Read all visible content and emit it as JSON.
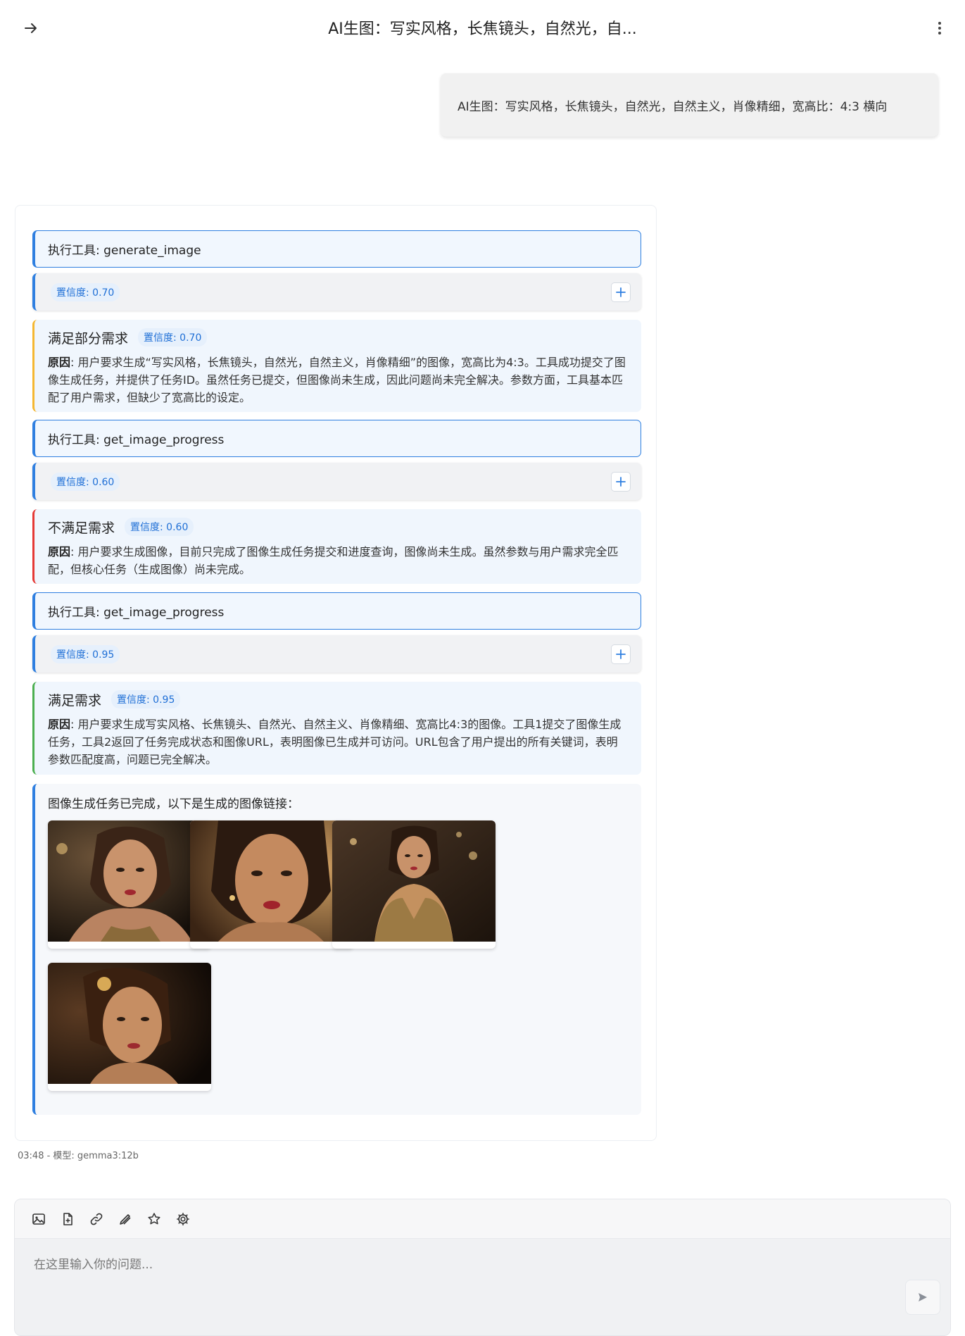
{
  "header": {
    "title": "AI生图：写实风格，长焦镜头，自然光，自..."
  },
  "user_message": {
    "text": "AI生图：写实风格，长焦镜头，自然光，自然主义，肖像精细，宽高比：4:3 横向"
  },
  "steps": [
    {
      "tool_label": "执行工具: generate_image",
      "confidence": "置信度: 0.70"
    },
    {
      "status": "满足部分需求",
      "confidence": "置信度: 0.70",
      "reason_label": "原因",
      "reason": ": 用户要求生成“写实风格，长焦镜头，自然光，自然主义，肖像精细”的图像，宽高比为4:3。工具成功提交了图像生成任务，并提供了任务ID。虽然任务已提交，但图像尚未生成，因此问题尚未完全解决。参数方面，工具基本匹配了用户需求，但缺少了宽高比的设定。"
    },
    {
      "tool_label": "执行工具: get_image_progress",
      "confidence": "置信度: 0.60"
    },
    {
      "status": "不满足需求",
      "confidence": "置信度: 0.60",
      "reason_label": "原因",
      "reason": ": 用户要求生成图像，目前只完成了图像生成任务提交和进度查询，图像尚未生成。虽然参数与用户需求完全匹配，但核心任务（生成图像）尚未完成。"
    },
    {
      "tool_label": "执行工具: get_image_progress",
      "confidence": "置信度: 0.95"
    },
    {
      "status": "满足需求",
      "confidence": "置信度: 0.95",
      "reason_label": "原因",
      "reason": ": 用户要求生成写实风格、长焦镜头、自然光、自然主义、肖像精细、宽高比4:3的图像。工具1提交了图像生成任务，工具2返回了任务完成状态和图像URL，表明图像已生成并可访问。URL包含了用户提出的所有关键词，表明参数匹配度高，问题已完全解决。"
    }
  ],
  "result": {
    "text": "图像生成任务已完成，以下是生成的图像链接：",
    "images": [
      "generated-portrait-1",
      "generated-portrait-2",
      "generated-portrait-3",
      "generated-portrait-4"
    ]
  },
  "meta": "03:48 - 模型: gemma3:12b",
  "input": {
    "placeholder": "在这里输入你的问题...",
    "toolbar_icons": [
      "image-icon",
      "file-add-icon",
      "link-icon",
      "pen-icon",
      "star-icon",
      "gear-icon"
    ],
    "send_icon": "send-icon"
  },
  "colors": {
    "accent": "#2f7fe0",
    "partial": "#f5b731",
    "fail": "#e53935",
    "ok": "#4caf50"
  }
}
